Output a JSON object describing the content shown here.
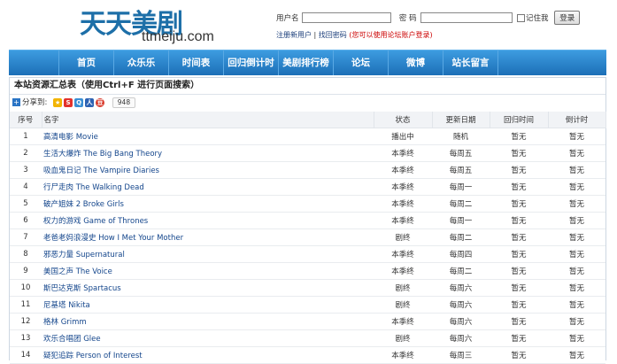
{
  "site": {
    "logo_cn": "天天美剧",
    "logo_en": "ttmeiju.com"
  },
  "login": {
    "username_label": "用户名",
    "password_label": "密 码",
    "remember_label": "记住我",
    "submit_label": "登录",
    "register_link": "注册新用户",
    "recover_link": "找回密码",
    "forum_note": "(您可以使用论坛账户登录)"
  },
  "nav": [
    "首页",
    "众乐乐",
    "时间表",
    "回归倒计时",
    "美剧排行榜",
    "论坛",
    "微博",
    "站长留言"
  ],
  "panel": {
    "title": "本站资源汇总表（使用Ctrl+F 进行页面搜索）"
  },
  "share": {
    "label": "分享到:",
    "count": "948",
    "icons": [
      "qzone-icon",
      "tsina-icon",
      "tqq-icon",
      "renren-icon",
      "douban-icon"
    ]
  },
  "table": {
    "headers": [
      "序号",
      "名字",
      "状态",
      "更新日期",
      "回归时间",
      "倒计时"
    ],
    "rows": [
      [
        "1",
        "高清电影 Movie",
        "播出中",
        "随机",
        "暂无",
        "暂无"
      ],
      [
        "2",
        "生活大爆炸 The Big Bang Theory",
        "本季终",
        "每周五",
        "暂无",
        "暂无"
      ],
      [
        "3",
        "吸血鬼日记 The Vampire Diaries",
        "本季终",
        "每周五",
        "暂无",
        "暂无"
      ],
      [
        "4",
        "行尸走肉 The Walking Dead",
        "本季终",
        "每周一",
        "暂无",
        "暂无"
      ],
      [
        "5",
        "破产姐妹 2 Broke Girls",
        "本季终",
        "每周二",
        "暂无",
        "暂无"
      ],
      [
        "6",
        "权力的游戏 Game of Thrones",
        "本季终",
        "每周一",
        "暂无",
        "暂无"
      ],
      [
        "7",
        "老爸老妈浪漫史 How I Met Your Mother",
        "剧终",
        "每周二",
        "暂无",
        "暂无"
      ],
      [
        "8",
        "邪恶力量 Supernatural",
        "本季终",
        "每周四",
        "暂无",
        "暂无"
      ],
      [
        "9",
        "美国之声 The Voice",
        "本季终",
        "每周二",
        "暂无",
        "暂无"
      ],
      [
        "10",
        "斯巴达克斯 Spartacus",
        "剧终",
        "每周六",
        "暂无",
        "暂无"
      ],
      [
        "11",
        "尼基塔 Nikita",
        "剧终",
        "每周六",
        "暂无",
        "暂无"
      ],
      [
        "12",
        "格林 Grimm",
        "本季终",
        "每周六",
        "暂无",
        "暂无"
      ],
      [
        "13",
        "欢乐合唱团 Glee",
        "剧终",
        "每周六",
        "暂无",
        "暂无"
      ],
      [
        "14",
        "疑犯追踪 Person of Interest",
        "本季终",
        "每周三",
        "暂无",
        "暂无"
      ]
    ]
  },
  "colors": {
    "nav_top": "#3d9ce0",
    "nav_bottom": "#1c6fb7",
    "link": "#14468c",
    "logo": "#1d6fa8",
    "note_red": "#cc0000"
  }
}
